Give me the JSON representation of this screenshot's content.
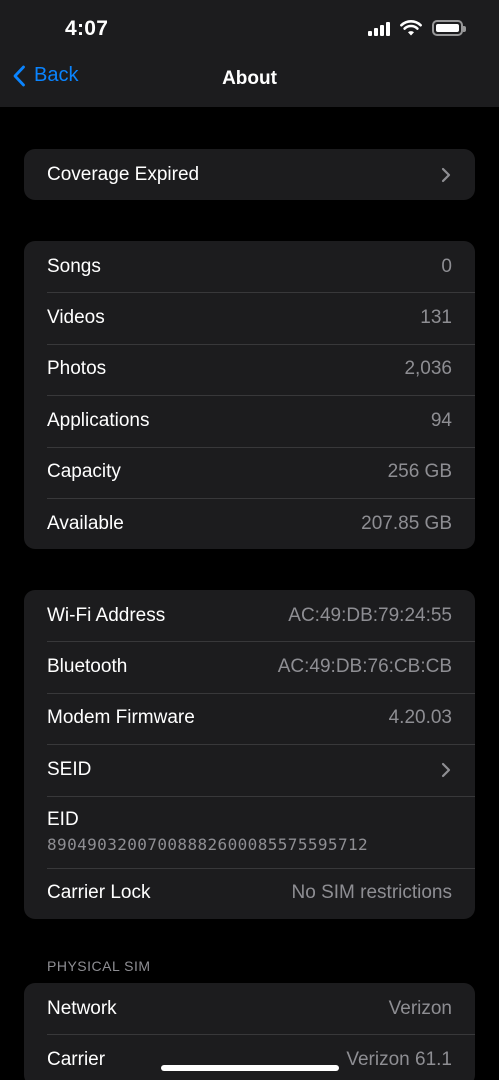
{
  "status": {
    "time": "4:07"
  },
  "nav": {
    "back_label": "Back",
    "title": "About"
  },
  "coverage": {
    "label": "Coverage Expired"
  },
  "media": [
    {
      "label": "Songs",
      "value": "0"
    },
    {
      "label": "Videos",
      "value": "131"
    },
    {
      "label": "Photos",
      "value": "2,036"
    },
    {
      "label": "Applications",
      "value": "94"
    },
    {
      "label": "Capacity",
      "value": "256 GB"
    },
    {
      "label": "Available",
      "value": "207.85 GB"
    }
  ],
  "network_info": {
    "wifi": {
      "label": "Wi-Fi Address",
      "value": "AC:49:DB:79:24:55"
    },
    "bluetooth": {
      "label": "Bluetooth",
      "value": "AC:49:DB:76:CB:CB"
    },
    "modem": {
      "label": "Modem Firmware",
      "value": "4.20.03"
    },
    "seid": {
      "label": "SEID"
    },
    "eid": {
      "label": "EID",
      "value": "89049032007008882600085575595712"
    },
    "carrier_lock": {
      "label": "Carrier Lock",
      "value": "No SIM restrictions"
    }
  },
  "physical_sim": {
    "header": "PHYSICAL SIM",
    "rows": [
      {
        "label": "Network",
        "value": "Verizon"
      },
      {
        "label": "Carrier",
        "value": "Verizon 61.1"
      }
    ]
  },
  "colors": {
    "accent": "#0a84ff",
    "cell_background": "#1c1c1e",
    "secondary_text": "#8e8e93"
  }
}
